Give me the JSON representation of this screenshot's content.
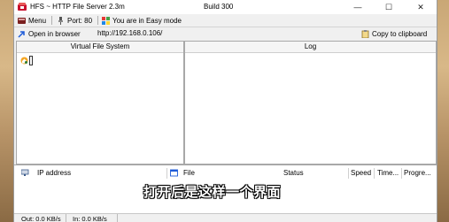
{
  "window": {
    "title": "HFS ~ HTTP File Server 2.3m",
    "build": "Build 300",
    "minimize_glyph": "—",
    "maximize_glyph": "☐",
    "close_glyph": "✕"
  },
  "menubar": {
    "menu_label": "Menu",
    "port_label": "Port: 80",
    "mode_label": "You are in Easy mode"
  },
  "urlbar": {
    "open_browser_label": "Open in browser",
    "url": "http://192.168.0.106/",
    "copy_label": "Copy to clipboard"
  },
  "panels": {
    "vfs_title": "Virtual File System",
    "log_title": "Log"
  },
  "connections": {
    "columns": [
      "IP address",
      "File",
      "Status",
      "Speed",
      "Time...",
      "Progre..."
    ]
  },
  "statusbar": {
    "out_speed": "Out: 0.0 KB/s",
    "in_speed": "In: 0.0 KB/s"
  },
  "subtitle": "打开后是这样一个界面",
  "colors": {
    "accent_blue": "#1e5bd8",
    "window_bg": "#f0f0f0"
  }
}
